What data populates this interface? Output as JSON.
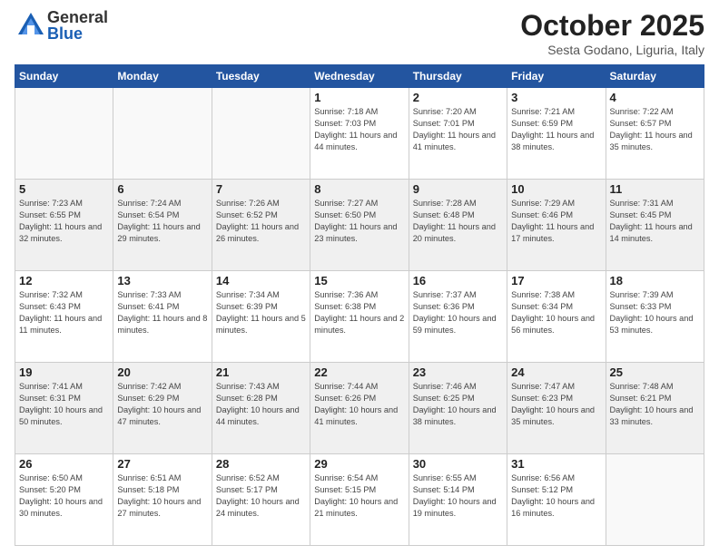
{
  "logo": {
    "general": "General",
    "blue": "Blue"
  },
  "header": {
    "month": "October 2025",
    "location": "Sesta Godano, Liguria, Italy"
  },
  "days_of_week": [
    "Sunday",
    "Monday",
    "Tuesday",
    "Wednesday",
    "Thursday",
    "Friday",
    "Saturday"
  ],
  "weeks": [
    [
      {
        "day": "",
        "sunrise": "",
        "sunset": "",
        "daylight": ""
      },
      {
        "day": "",
        "sunrise": "",
        "sunset": "",
        "daylight": ""
      },
      {
        "day": "",
        "sunrise": "",
        "sunset": "",
        "daylight": ""
      },
      {
        "day": "1",
        "sunrise": "Sunrise: 7:18 AM",
        "sunset": "Sunset: 7:03 PM",
        "daylight": "Daylight: 11 hours and 44 minutes."
      },
      {
        "day": "2",
        "sunrise": "Sunrise: 7:20 AM",
        "sunset": "Sunset: 7:01 PM",
        "daylight": "Daylight: 11 hours and 41 minutes."
      },
      {
        "day": "3",
        "sunrise": "Sunrise: 7:21 AM",
        "sunset": "Sunset: 6:59 PM",
        "daylight": "Daylight: 11 hours and 38 minutes."
      },
      {
        "day": "4",
        "sunrise": "Sunrise: 7:22 AM",
        "sunset": "Sunset: 6:57 PM",
        "daylight": "Daylight: 11 hours and 35 minutes."
      }
    ],
    [
      {
        "day": "5",
        "sunrise": "Sunrise: 7:23 AM",
        "sunset": "Sunset: 6:55 PM",
        "daylight": "Daylight: 11 hours and 32 minutes."
      },
      {
        "day": "6",
        "sunrise": "Sunrise: 7:24 AM",
        "sunset": "Sunset: 6:54 PM",
        "daylight": "Daylight: 11 hours and 29 minutes."
      },
      {
        "day": "7",
        "sunrise": "Sunrise: 7:26 AM",
        "sunset": "Sunset: 6:52 PM",
        "daylight": "Daylight: 11 hours and 26 minutes."
      },
      {
        "day": "8",
        "sunrise": "Sunrise: 7:27 AM",
        "sunset": "Sunset: 6:50 PM",
        "daylight": "Daylight: 11 hours and 23 minutes."
      },
      {
        "day": "9",
        "sunrise": "Sunrise: 7:28 AM",
        "sunset": "Sunset: 6:48 PM",
        "daylight": "Daylight: 11 hours and 20 minutes."
      },
      {
        "day": "10",
        "sunrise": "Sunrise: 7:29 AM",
        "sunset": "Sunset: 6:46 PM",
        "daylight": "Daylight: 11 hours and 17 minutes."
      },
      {
        "day": "11",
        "sunrise": "Sunrise: 7:31 AM",
        "sunset": "Sunset: 6:45 PM",
        "daylight": "Daylight: 11 hours and 14 minutes."
      }
    ],
    [
      {
        "day": "12",
        "sunrise": "Sunrise: 7:32 AM",
        "sunset": "Sunset: 6:43 PM",
        "daylight": "Daylight: 11 hours and 11 minutes."
      },
      {
        "day": "13",
        "sunrise": "Sunrise: 7:33 AM",
        "sunset": "Sunset: 6:41 PM",
        "daylight": "Daylight: 11 hours and 8 minutes."
      },
      {
        "day": "14",
        "sunrise": "Sunrise: 7:34 AM",
        "sunset": "Sunset: 6:39 PM",
        "daylight": "Daylight: 11 hours and 5 minutes."
      },
      {
        "day": "15",
        "sunrise": "Sunrise: 7:36 AM",
        "sunset": "Sunset: 6:38 PM",
        "daylight": "Daylight: 11 hours and 2 minutes."
      },
      {
        "day": "16",
        "sunrise": "Sunrise: 7:37 AM",
        "sunset": "Sunset: 6:36 PM",
        "daylight": "Daylight: 10 hours and 59 minutes."
      },
      {
        "day": "17",
        "sunrise": "Sunrise: 7:38 AM",
        "sunset": "Sunset: 6:34 PM",
        "daylight": "Daylight: 10 hours and 56 minutes."
      },
      {
        "day": "18",
        "sunrise": "Sunrise: 7:39 AM",
        "sunset": "Sunset: 6:33 PM",
        "daylight": "Daylight: 10 hours and 53 minutes."
      }
    ],
    [
      {
        "day": "19",
        "sunrise": "Sunrise: 7:41 AM",
        "sunset": "Sunset: 6:31 PM",
        "daylight": "Daylight: 10 hours and 50 minutes."
      },
      {
        "day": "20",
        "sunrise": "Sunrise: 7:42 AM",
        "sunset": "Sunset: 6:29 PM",
        "daylight": "Daylight: 10 hours and 47 minutes."
      },
      {
        "day": "21",
        "sunrise": "Sunrise: 7:43 AM",
        "sunset": "Sunset: 6:28 PM",
        "daylight": "Daylight: 10 hours and 44 minutes."
      },
      {
        "day": "22",
        "sunrise": "Sunrise: 7:44 AM",
        "sunset": "Sunset: 6:26 PM",
        "daylight": "Daylight: 10 hours and 41 minutes."
      },
      {
        "day": "23",
        "sunrise": "Sunrise: 7:46 AM",
        "sunset": "Sunset: 6:25 PM",
        "daylight": "Daylight: 10 hours and 38 minutes."
      },
      {
        "day": "24",
        "sunrise": "Sunrise: 7:47 AM",
        "sunset": "Sunset: 6:23 PM",
        "daylight": "Daylight: 10 hours and 35 minutes."
      },
      {
        "day": "25",
        "sunrise": "Sunrise: 7:48 AM",
        "sunset": "Sunset: 6:21 PM",
        "daylight": "Daylight: 10 hours and 33 minutes."
      }
    ],
    [
      {
        "day": "26",
        "sunrise": "Sunrise: 6:50 AM",
        "sunset": "Sunset: 5:20 PM",
        "daylight": "Daylight: 10 hours and 30 minutes."
      },
      {
        "day": "27",
        "sunrise": "Sunrise: 6:51 AM",
        "sunset": "Sunset: 5:18 PM",
        "daylight": "Daylight: 10 hours and 27 minutes."
      },
      {
        "day": "28",
        "sunrise": "Sunrise: 6:52 AM",
        "sunset": "Sunset: 5:17 PM",
        "daylight": "Daylight: 10 hours and 24 minutes."
      },
      {
        "day": "29",
        "sunrise": "Sunrise: 6:54 AM",
        "sunset": "Sunset: 5:15 PM",
        "daylight": "Daylight: 10 hours and 21 minutes."
      },
      {
        "day": "30",
        "sunrise": "Sunrise: 6:55 AM",
        "sunset": "Sunset: 5:14 PM",
        "daylight": "Daylight: 10 hours and 19 minutes."
      },
      {
        "day": "31",
        "sunrise": "Sunrise: 6:56 AM",
        "sunset": "Sunset: 5:12 PM",
        "daylight": "Daylight: 10 hours and 16 minutes."
      },
      {
        "day": "",
        "sunrise": "",
        "sunset": "",
        "daylight": ""
      }
    ]
  ]
}
